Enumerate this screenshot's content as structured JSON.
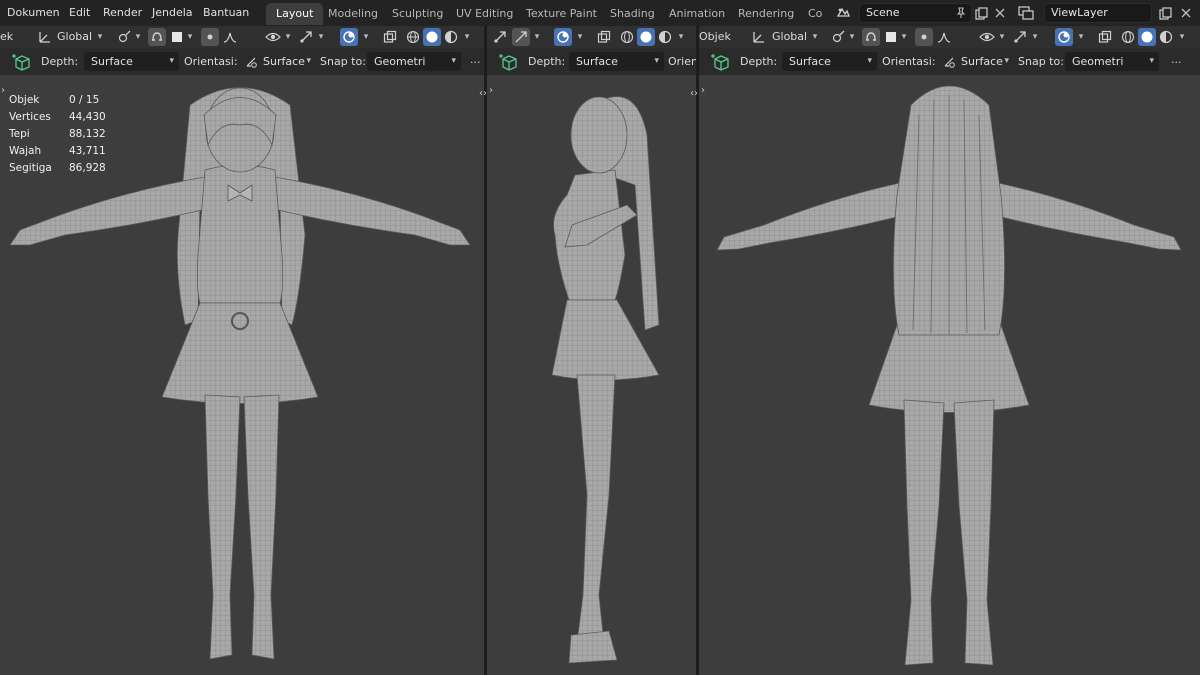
{
  "menu": [
    "Dokumen",
    "Edit",
    "Render",
    "Jendela",
    "Bantuan"
  ],
  "workspaces": [
    "Layout",
    "Modeling",
    "Sculpting",
    "UV Editing",
    "Texture Paint",
    "Shading",
    "Animation",
    "Rendering",
    "Co"
  ],
  "active_workspace": "Layout",
  "scene": {
    "name": "Scene"
  },
  "view_layer": {
    "name": "ViewLayer"
  },
  "header": {
    "mode_fragment": "ek",
    "mode_label": "Objek",
    "transform_orientation": "Global"
  },
  "tool_settings": {
    "depth_label": "Depth:",
    "depth_value": "Surface",
    "orientation_label": "Orientasi:",
    "orientation_value": "Surface",
    "orientation_fragment": "Orient",
    "snap_label": "Snap to:",
    "snap_value": "Geometri",
    "more": "..."
  },
  "stats": [
    {
      "label": "Objek",
      "value": "0 / 15"
    },
    {
      "label": "Vertices",
      "value": "44,430"
    },
    {
      "label": "Tepi",
      "value": "88,132"
    },
    {
      "label": "Wajah",
      "value": "43,711"
    },
    {
      "label": "Segitiga",
      "value": "86,928"
    }
  ],
  "colors": {
    "accent": "#4772b3",
    "viewport_bg": "#3d3d3d",
    "header_bg": "#303030",
    "mesh": "#a9a9a9"
  }
}
